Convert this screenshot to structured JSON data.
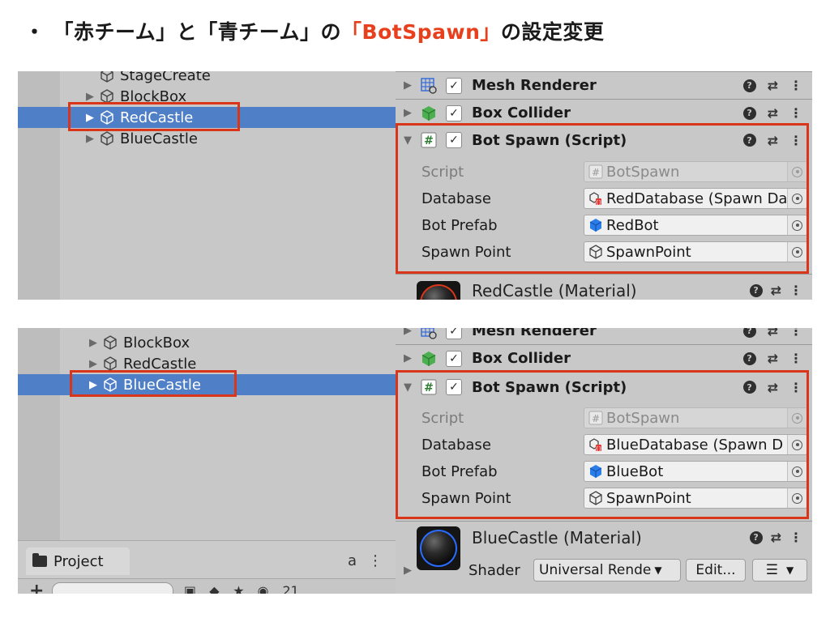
{
  "heading": {
    "bullet": "・",
    "part1": "「赤チーム」と「青チーム」の",
    "accent": "「BotSpawn」",
    "part2": "の設定変更"
  },
  "colors": {
    "accent": "#e8401c",
    "highlight": "#d9351b",
    "selection": "#4f7fc6"
  },
  "panels": [
    {
      "hierarchy": [
        {
          "label": "StageCreate",
          "arrow": "",
          "selected": false
        },
        {
          "label": "BlockBox",
          "arrow": "▶",
          "selected": false
        },
        {
          "label": "RedCastle",
          "arrow": "▶",
          "selected": true
        },
        {
          "label": "BlueCastle",
          "arrow": "▶",
          "selected": false
        }
      ],
      "components": [
        {
          "name": "Mesh Renderer",
          "icon": "mesh-renderer-icon",
          "fold": "▶"
        },
        {
          "name": "Box Collider",
          "icon": "box-collider-icon",
          "fold": "▶"
        },
        {
          "name": "Bot Spawn (Script)",
          "icon": "script-icon",
          "fold": "▼"
        }
      ],
      "properties": [
        {
          "label": "Script",
          "value": "BotSpawn",
          "icon": "script-icon",
          "disabled": true
        },
        {
          "label": "Database",
          "value": "RedDatabase (Spawn Da",
          "icon": "scriptable-object-icon",
          "disabled": false
        },
        {
          "label": "Bot Prefab",
          "value": "RedBot",
          "icon": "prefab-icon",
          "disabled": false
        },
        {
          "label": "Spawn Point",
          "value": "SpawnPoint",
          "icon": "gameobject-icon",
          "disabled": false
        }
      ],
      "material": {
        "name": "RedCastle (Material)"
      }
    },
    {
      "hierarchy": [
        {
          "label": "BlockBox",
          "arrow": "▶",
          "selected": false
        },
        {
          "label": "RedCastle",
          "arrow": "▶",
          "selected": false
        },
        {
          "label": "BlueCastle",
          "arrow": "▶",
          "selected": true
        }
      ],
      "components": [
        {
          "name": "Mesh Renderer",
          "icon": "mesh-renderer-icon",
          "fold": "▶"
        },
        {
          "name": "Box Collider",
          "icon": "box-collider-icon",
          "fold": "▶"
        },
        {
          "name": "Bot Spawn (Script)",
          "icon": "script-icon",
          "fold": "▼"
        }
      ],
      "properties": [
        {
          "label": "Script",
          "value": "BotSpawn",
          "icon": "script-icon",
          "disabled": true
        },
        {
          "label": "Database",
          "value": "BlueDatabase (Spawn D",
          "icon": "scriptable-object-icon",
          "disabled": false
        },
        {
          "label": "Bot Prefab",
          "value": "BlueBot",
          "icon": "prefab-icon",
          "disabled": false
        },
        {
          "label": "Spawn Point",
          "value": "SpawnPoint",
          "icon": "gameobject-icon",
          "disabled": false
        }
      ],
      "material": {
        "name": "BlueCastle (Material)",
        "shader_label": "Shader",
        "shader_value": "Universal Rende",
        "edit_button": "Edit..."
      },
      "project": {
        "tab_label": "Project",
        "count": "21"
      }
    }
  ],
  "tools": {
    "help": "?",
    "preset": "⇄",
    "menu": "⋮",
    "plus": "+",
    "lock": "a"
  }
}
